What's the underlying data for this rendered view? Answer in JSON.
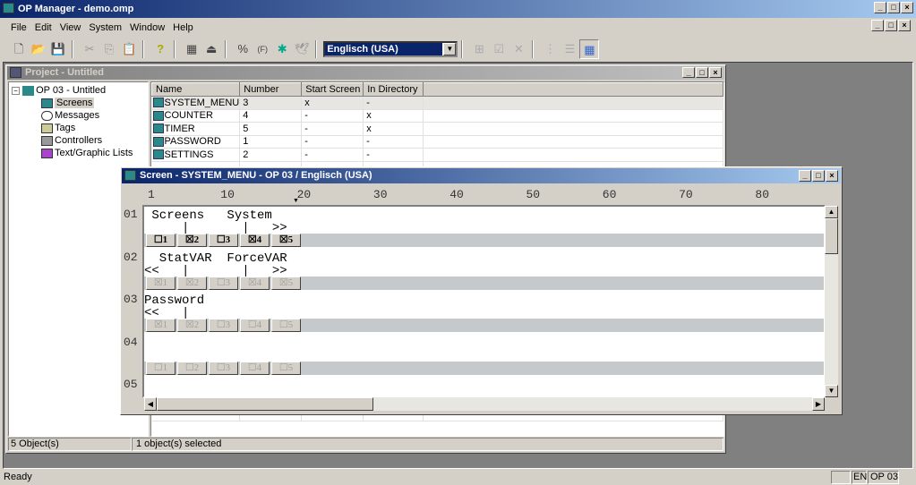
{
  "app": {
    "title": "OP Manager - demo.omp",
    "status": "Ready",
    "status_lang": "EN",
    "status_device": "OP 03"
  },
  "menu": [
    "File",
    "Edit",
    "View",
    "System",
    "Window",
    "Help"
  ],
  "toolbar": {
    "language_select": "Englisch (USA)",
    "icons": [
      "new-icon",
      "open-icon",
      "save-icon",
      "cut-icon",
      "copy-icon",
      "paste-icon",
      "help-icon",
      "download-icon",
      "upload-icon",
      "percent-icon",
      "function-icon",
      "settings-icon",
      "bird-icon",
      "insert-icon",
      "properties-icon",
      "delete-icon",
      "tree-view-icon",
      "list-view-icon",
      "detail-view-icon"
    ]
  },
  "project": {
    "title": "Project - Untitled",
    "tree": {
      "root": "OP 03 - Untitled",
      "items": [
        "Screens",
        "Messages",
        "Tags",
        "Controllers",
        "Text/Graphic Lists"
      ],
      "selected": "Screens"
    },
    "columns": [
      "Name",
      "Number",
      "Start Screen",
      "In Directory"
    ],
    "rows": [
      [
        "SYSTEM_MENU",
        "3",
        "x",
        "-"
      ],
      [
        "COUNTER",
        "4",
        "-",
        "x"
      ],
      [
        "TIMER",
        "5",
        "-",
        "x"
      ],
      [
        "PASSWORD",
        "1",
        "-",
        "-"
      ],
      [
        "SETTINGS",
        "2",
        "-",
        "-"
      ]
    ],
    "status_left": "5  Object(s)",
    "status_right": "1  object(s) selected"
  },
  "screen": {
    "title": "Screen - SYSTEM_MENU - OP 03 / Englisch (USA)",
    "ruler": [
      "1",
      "10",
      "20",
      "30",
      "40",
      "50",
      "60",
      "70",
      "80"
    ],
    "row_labels": [
      "01",
      "02",
      "03",
      "04",
      "05"
    ],
    "blocks": [
      {
        "lines": [
          " Screens   System",
          "     |       |   >>"
        ],
        "softkeys": [
          "☐1",
          "☒2",
          "☐3",
          "☒4",
          "☒5"
        ],
        "enabled": true
      },
      {
        "lines": [
          "  StatVAR  ForceVAR",
          "<<   |       |   >>"
        ],
        "softkeys": [
          "☒1",
          "☒2",
          "☐3",
          "☒4",
          "☒5"
        ],
        "enabled": false
      },
      {
        "lines": [
          "Password",
          "<<   |"
        ],
        "softkeys": [
          "☒1",
          "☒2",
          "☐3",
          "☐4",
          "☐5"
        ],
        "enabled": false
      },
      {
        "lines": [
          "",
          ""
        ],
        "softkeys": [
          "☐1",
          "☐2",
          "☐3",
          "☐4",
          "☐5"
        ],
        "enabled": false
      }
    ]
  }
}
